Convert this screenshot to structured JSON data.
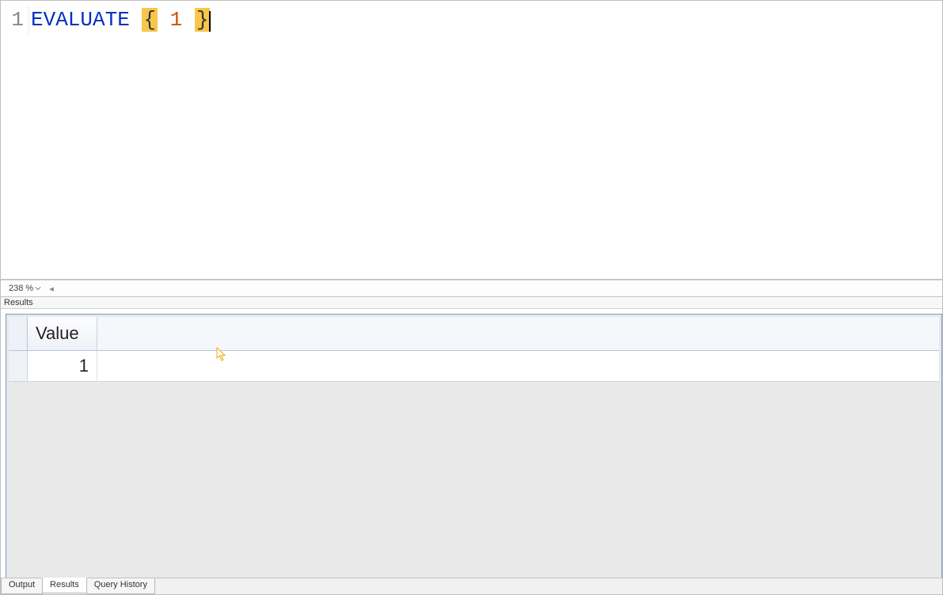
{
  "editor": {
    "line_number": "1",
    "tokens": {
      "keyword": "EVALUATE",
      "open_brace": "{",
      "literal": "1",
      "close_brace": "}"
    }
  },
  "zoom": {
    "value": "238 %"
  },
  "results": {
    "panel_label": "Results",
    "columns": [
      "Value"
    ],
    "rows": [
      [
        "1"
      ]
    ]
  },
  "tabs": {
    "output": "Output",
    "results": "Results",
    "query_history": "Query History"
  }
}
